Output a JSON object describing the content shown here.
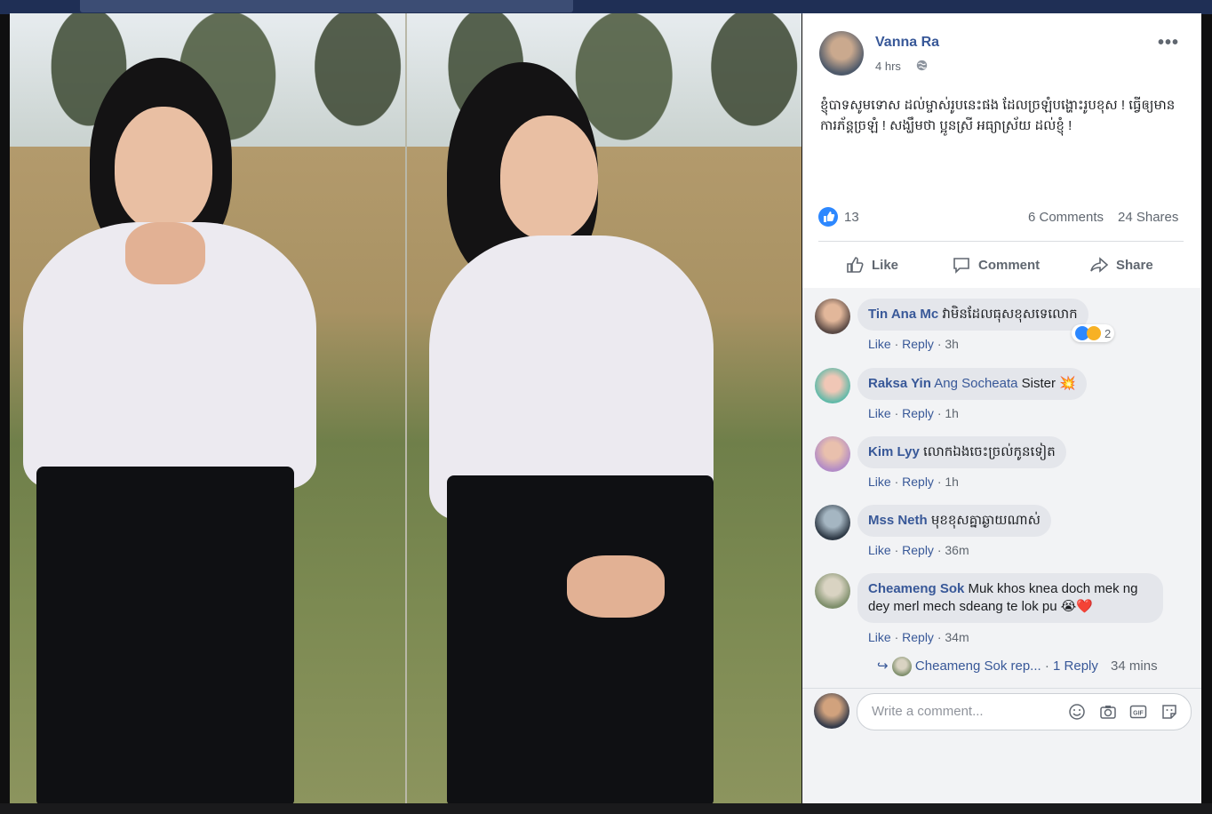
{
  "post": {
    "author": "Vanna Ra",
    "time": "4 hrs",
    "text": "ខ្ញុំបាទសូមទោស ដល់ម្ចាស់រូបនេះផង ដែលច្រឡំបង្ហោះរូបខុស ! ធ្វើឲ្យមានការភ័ន្តច្រឡំ ! សង្ឃឹមថា ប្អូនស្រី អធ្យាស្រ័យ ដល់ខ្ញុំ !",
    "more_icon": "more-icon",
    "privacy_icon": "globe-icon"
  },
  "stats": {
    "likes": "13",
    "comments": "6 Comments",
    "shares": "24 Shares"
  },
  "actions": {
    "like": "Like",
    "comment": "Comment",
    "share": "Share"
  },
  "comments": [
    {
      "name": "Tin Ana Mc",
      "mention": "",
      "text": "វាមិនដែលធុសខុសទេលោក",
      "like": "Like",
      "reply": "Reply",
      "time": "3h",
      "reactions": "2"
    },
    {
      "name": "Raksa Yin",
      "mention": "Ang Socheata",
      "text": "Sister 💥",
      "like": "Like",
      "reply": "Reply",
      "time": "1h"
    },
    {
      "name": "Kim Lyy",
      "mention": "",
      "text": "លោកឯងចេះច្រល់កូនទៀត",
      "like": "Like",
      "reply": "Reply",
      "time": "1h"
    },
    {
      "name": "Mss Neth",
      "mention": "",
      "text": "មុខខុសគ្នាឆ្ងាយណាស់",
      "like": "Like",
      "reply": "Reply",
      "time": "36m"
    },
    {
      "name": "Cheameng Sok",
      "mention": "",
      "text": "Muk khos knea doch mek ng dey merl mech sdeang te lok pu 😭❤️",
      "like": "Like",
      "reply": "Reply",
      "time": "34m"
    }
  ],
  "replies_summary": {
    "name": "Cheameng Sok rep...",
    "count": "1 Reply",
    "time": "34 mins"
  },
  "write_comment": {
    "placeholder": "Write a comment..."
  },
  "colors": {
    "link": "#385898",
    "like_blue": "#2d88ff",
    "panel_bg": "#ffffff",
    "comment_bg": "#e4e6eb"
  }
}
